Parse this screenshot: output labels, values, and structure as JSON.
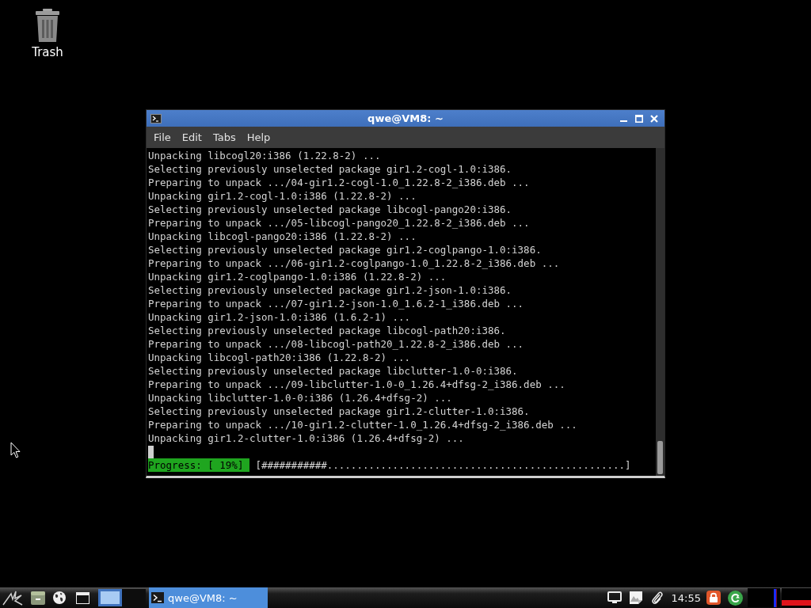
{
  "desktop": {
    "icons": [
      {
        "kind": "trash",
        "label": "Trash"
      }
    ]
  },
  "window": {
    "title": "qwe@VM8: ~",
    "menu": [
      "File",
      "Edit",
      "Tabs",
      "Help"
    ],
    "terminal": {
      "lines": [
        "Unpacking libcogl20:i386 (1.22.8-2) ...",
        "Selecting previously unselected package gir1.2-cogl-1.0:i386.",
        "Preparing to unpack .../04-gir1.2-cogl-1.0_1.22.8-2_i386.deb ...",
        "Unpacking gir1.2-cogl-1.0:i386 (1.22.8-2) ...",
        "Selecting previously unselected package libcogl-pango20:i386.",
        "Preparing to unpack .../05-libcogl-pango20_1.22.8-2_i386.deb ...",
        "Unpacking libcogl-pango20:i386 (1.22.8-2) ...",
        "Selecting previously unselected package gir1.2-coglpango-1.0:i386.",
        "Preparing to unpack .../06-gir1.2-coglpango-1.0_1.22.8-2_i386.deb ...",
        "Unpacking gir1.2-coglpango-1.0:i386 (1.22.8-2) ...",
        "Selecting previously unselected package gir1.2-json-1.0:i386.",
        "Preparing to unpack .../07-gir1.2-json-1.0_1.6.2-1_i386.deb ...",
        "Unpacking gir1.2-json-1.0:i386 (1.6.2-1) ...",
        "Selecting previously unselected package libcogl-path20:i386.",
        "Preparing to unpack .../08-libcogl-path20_1.22.8-2_i386.deb ...",
        "Unpacking libcogl-path20:i386 (1.22.8-2) ...",
        "Selecting previously unselected package libclutter-1.0-0:i386.",
        "Preparing to unpack .../09-libclutter-1.0-0_1.26.4+dfsg-2_i386.deb ...",
        "Unpacking libclutter-1.0-0:i386 (1.26.4+dfsg-2) ...",
        "Selecting previously unselected package gir1.2-clutter-1.0:i386.",
        "Preparing to unpack .../10-gir1.2-clutter-1.0_1.26.4+dfsg-2_i386.deb ...",
        "Unpacking gir1.2-clutter-1.0:i386 (1.26.4+dfsg-2) ..."
      ],
      "progress": {
        "label": "Progress: [ 19%]",
        "bar": "[###########..................................................]"
      }
    }
  },
  "taskbar": {
    "workspaces": [
      {
        "selected": true
      },
      {
        "selected": false
      }
    ],
    "tasks": [
      {
        "label": "qwe@VM8: ~",
        "selected": true
      }
    ],
    "clock": "14:55"
  }
}
